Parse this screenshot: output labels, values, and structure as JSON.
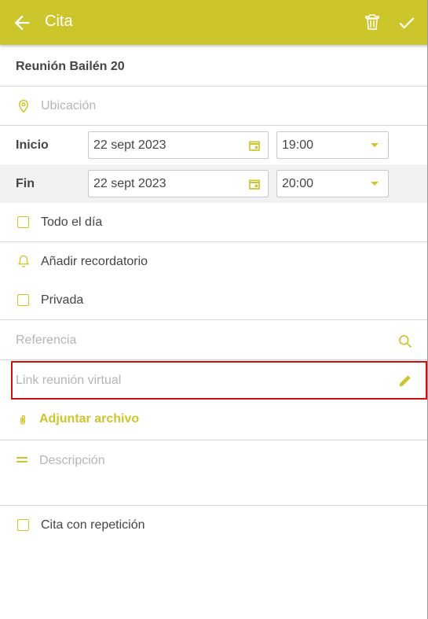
{
  "header": {
    "title": "Cita"
  },
  "event": {
    "name": "Reunión Bailén 20"
  },
  "location": {
    "placeholder": "Ubicación"
  },
  "start": {
    "label": "Inicio",
    "date": "22 sept 2023",
    "time": "19:00"
  },
  "end": {
    "label": "Fin",
    "date": "22 sept 2023",
    "time": "20:00"
  },
  "all_day": {
    "label": "Todo el día",
    "checked": false
  },
  "reminder": {
    "label": "Añadir recordatorio"
  },
  "private": {
    "label": "Privada",
    "checked": false
  },
  "reference": {
    "placeholder": "Referencia"
  },
  "virtual_link": {
    "placeholder": "Link reunión virtual"
  },
  "attachment": {
    "label": "Adjuntar archivo"
  },
  "description": {
    "placeholder": "Descripción"
  },
  "repeat": {
    "label": "Cita con repetición",
    "checked": false
  },
  "colors": {
    "accent": "#cdc52c",
    "highlight_border": "#d10f0f",
    "divider": "#d6d6d6"
  },
  "icons": [
    "back-arrow-icon",
    "trash-icon",
    "check-icon",
    "location-pin-icon",
    "calendar-icon",
    "dropdown-caret-icon",
    "bell-icon",
    "search-icon",
    "pencil-icon",
    "paperclip-icon",
    "description-icon"
  ]
}
